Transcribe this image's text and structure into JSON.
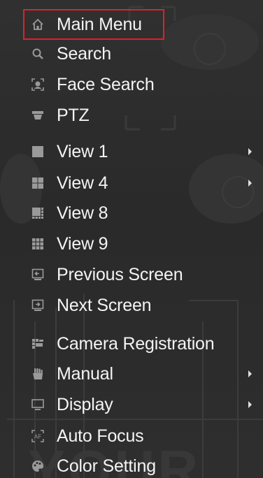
{
  "menu": {
    "items": [
      {
        "label": "Main Menu",
        "icon": "home-icon",
        "submenu": false,
        "selected": true
      },
      {
        "label": "Search",
        "icon": "search-icon",
        "submenu": false
      },
      {
        "label": "Face Search",
        "icon": "face-search-icon",
        "submenu": false
      },
      {
        "label": "PTZ",
        "icon": "ptz-camera-icon",
        "submenu": false
      },
      {
        "label": "View 1",
        "icon": "view-1-grid-icon",
        "submenu": true
      },
      {
        "label": "View 4",
        "icon": "view-4-grid-icon",
        "submenu": true
      },
      {
        "label": "View 8",
        "icon": "view-8-grid-icon",
        "submenu": false
      },
      {
        "label": "View 9",
        "icon": "view-9-grid-icon",
        "submenu": false
      },
      {
        "label": "Previous Screen",
        "icon": "previous-screen-icon",
        "submenu": false
      },
      {
        "label": "Next Screen",
        "icon": "next-screen-icon",
        "submenu": false
      },
      {
        "label": "Camera Registration",
        "icon": "camera-registration-icon",
        "submenu": false
      },
      {
        "label": "Manual",
        "icon": "manual-icon",
        "submenu": true
      },
      {
        "label": "Display",
        "icon": "display-icon",
        "submenu": true
      },
      {
        "label": "Auto Focus",
        "icon": "auto-focus-icon",
        "submenu": false
      },
      {
        "label": "Color Setting",
        "icon": "color-setting-icon",
        "submenu": false
      }
    ]
  },
  "colors": {
    "background": "#2b2b2b",
    "text": "#f4f4f4",
    "icon": "#9a9a9a",
    "selection_border": "#e0202a"
  }
}
